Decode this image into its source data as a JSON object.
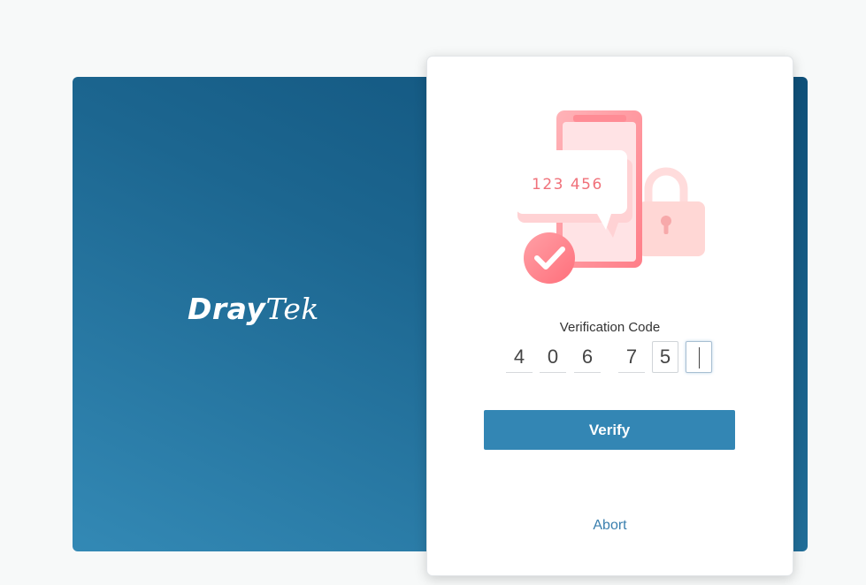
{
  "brand": {
    "logo_part1": "Dray",
    "logo_part2": "Tek",
    "panel_color": "#1c6690"
  },
  "card": {
    "illustration": {
      "icon": "phone-verification-illustration",
      "bubble_text": "123 456",
      "check_icon": "checkmark-icon",
      "lock_icon": "padlock-icon",
      "accent_color": "#f0717a"
    },
    "verification_label": "Verification Code",
    "digits": [
      "4",
      "0",
      "6",
      "7",
      "5",
      ""
    ],
    "verify_label": "Verify",
    "abort_label": "Abort",
    "button_color": "#3386b4",
    "link_color": "#3a7fae"
  }
}
